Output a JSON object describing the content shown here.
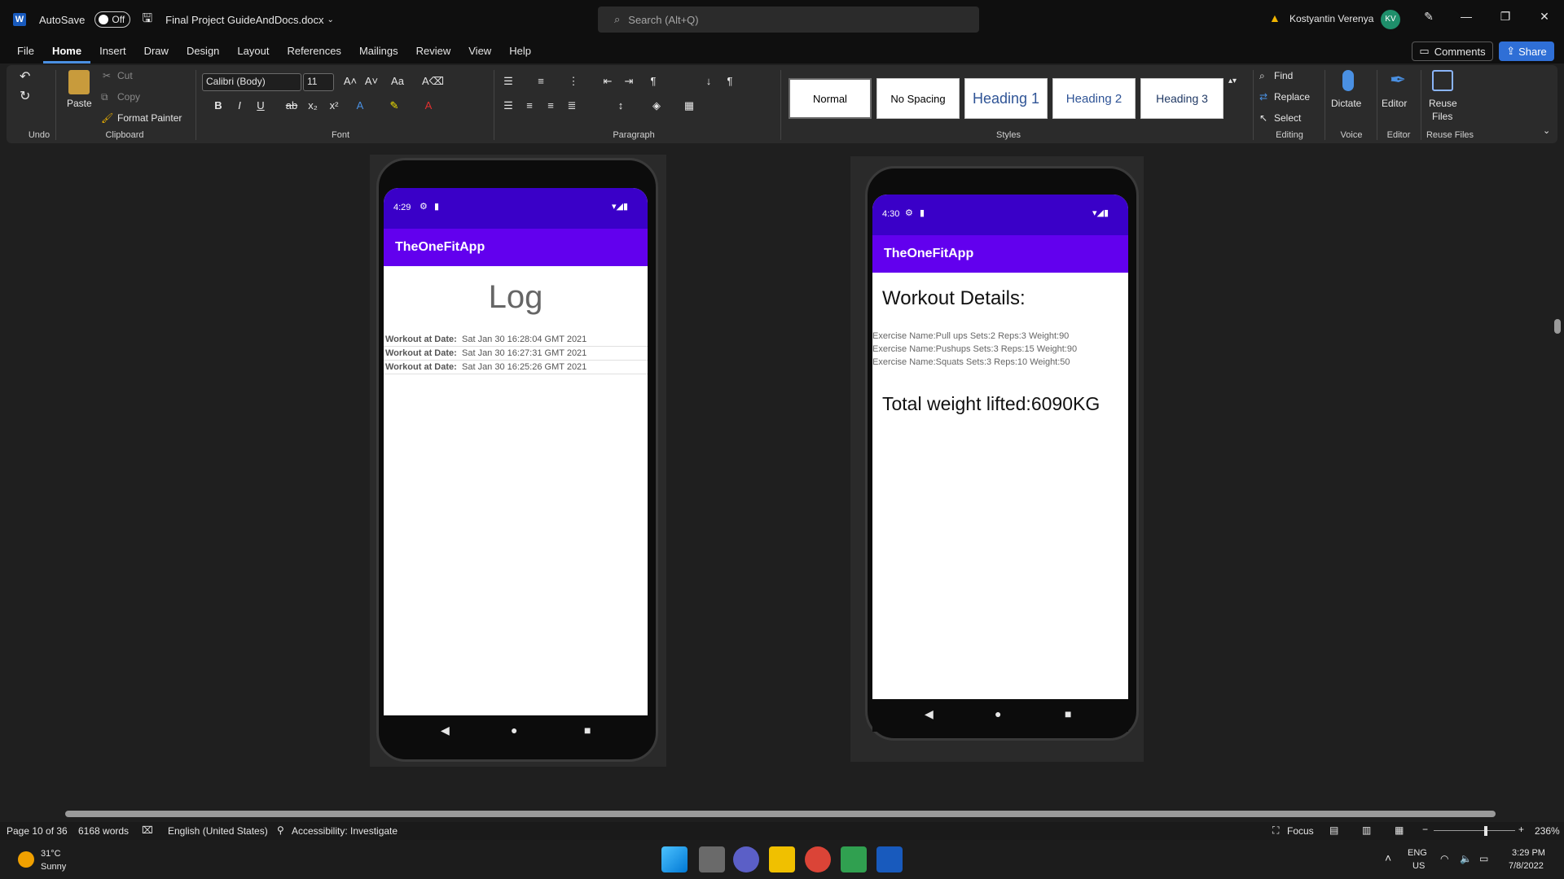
{
  "titlebar": {
    "autosave_label": "AutoSave",
    "autosave_state": "Off",
    "doc_title": "Final Project GuideAndDocs.docx",
    "search_placeholder": "Search (Alt+Q)",
    "user_name": "Kostyantin Verenya",
    "user_initials": "KV"
  },
  "menu": {
    "items": [
      "File",
      "Home",
      "Insert",
      "Draw",
      "Design",
      "Layout",
      "References",
      "Mailings",
      "Review",
      "View",
      "Help"
    ],
    "active": "Home",
    "comments_label": "Comments",
    "share_label": "Share"
  },
  "ribbon": {
    "undo_label": "Undo",
    "clipboard": {
      "paste": "Paste",
      "cut": "Cut",
      "copy": "Copy",
      "format_painter": "Format Painter",
      "group": "Clipboard"
    },
    "font": {
      "family": "Calibri (Body)",
      "size": "11",
      "group": "Font"
    },
    "paragraph_group": "Paragraph",
    "styles": {
      "items": [
        "Normal",
        "No Spacing",
        "Heading 1",
        "Heading 2",
        "Heading 3"
      ],
      "group": "Styles"
    },
    "editing": {
      "find": "Find",
      "replace": "Replace",
      "select": "Select",
      "group": "Editing"
    },
    "voice": {
      "dictate": "Dictate",
      "group": "Voice"
    },
    "editor": {
      "label": "Editor",
      "group": "Editor"
    },
    "reuse": {
      "label1": "Reuse",
      "label2": "Files",
      "group": "Reuse Files"
    }
  },
  "phone_left": {
    "time": "4:29",
    "app_title": "TheOneFitApp",
    "heading": "Log",
    "row_label": "Workout at Date:",
    "rows": [
      "Sat Jan 30 16:28:04 GMT 2021",
      "Sat Jan 30 16:27:31 GMT 2021",
      "Sat Jan 30 16:25:26 GMT 2021"
    ]
  },
  "phone_right": {
    "time": "4:30",
    "app_title": "TheOneFitApp",
    "heading": "Workout Details:",
    "exercises": [
      "Exercise Name:Pull ups    Sets:2    Reps:3    Weight:90",
      "Exercise Name:Pushups    Sets:3    Reps:15    Weight:90",
      "Exercise Name:Squats    Sets:3    Reps:10    Weight:50"
    ],
    "total": "Total weight lifted:6090KG"
  },
  "statusline": {
    "page": "Page 10 of 36",
    "words": "6168 words",
    "language": "English (United States)",
    "accessibility": "Accessibility: Investigate",
    "focus": "Focus",
    "zoom": "236%"
  },
  "taskbar": {
    "temperature": "31°C",
    "weather": "Sunny",
    "lang": "ENG",
    "region": "US",
    "time": "3:29 PM",
    "date": "7/8/2022"
  }
}
